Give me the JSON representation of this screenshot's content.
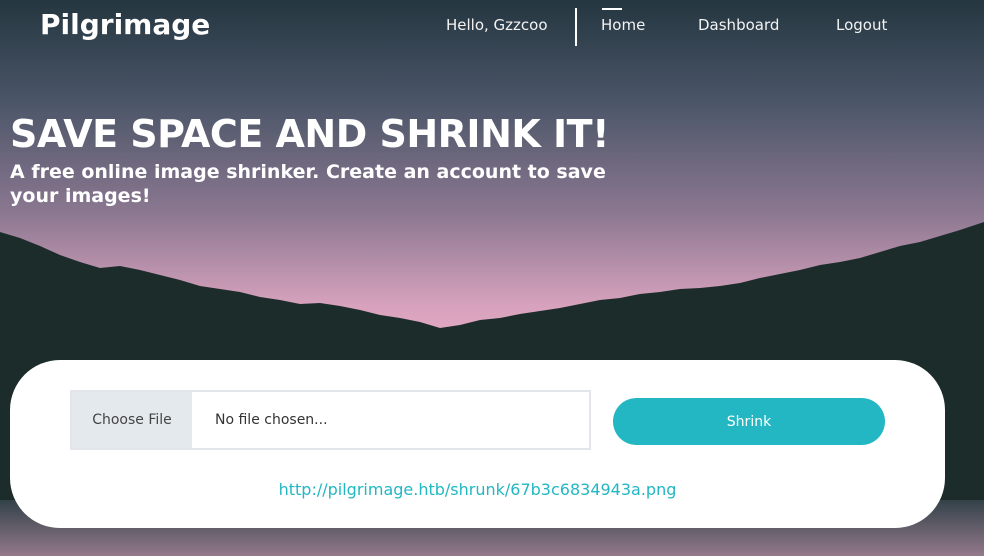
{
  "brand": {
    "name": "Pilgrimage"
  },
  "nav": {
    "greeting": "Hello, Gzzcoo",
    "items": [
      {
        "label": "Home",
        "active": true
      },
      {
        "label": "Dashboard"
      },
      {
        "label": "Logout"
      }
    ]
  },
  "hero": {
    "title": "SAVE SPACE AND SHRINK IT!",
    "subtitle": "A free online image shrinker. Create an account to save your images!"
  },
  "upload": {
    "choose_label": "Choose File",
    "file_name": "No file chosen...",
    "submit_label": "Shrink",
    "result_link": "http://pilgrimage.htb/shrunk/67b3c6834943a.png"
  },
  "colors": {
    "accent": "#22b7c2",
    "sky_top": "#243640",
    "sky_bottom": "#e6a9c2",
    "mountains": "#1c2c2b"
  }
}
